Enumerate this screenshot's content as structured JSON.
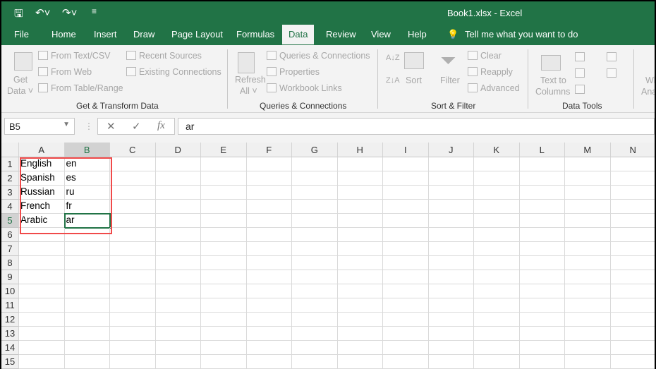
{
  "window": {
    "title": "Book1.xlsx  -  Excel"
  },
  "quick_access": {
    "icons": [
      "save-icon",
      "undo-icon",
      "redo-icon",
      "customize-icon"
    ]
  },
  "tabs": [
    {
      "label": "File"
    },
    {
      "label": "Home"
    },
    {
      "label": "Insert"
    },
    {
      "label": "Draw"
    },
    {
      "label": "Page Layout"
    },
    {
      "label": "Formulas"
    },
    {
      "label": "Data",
      "active": true
    },
    {
      "label": "Review"
    },
    {
      "label": "View"
    },
    {
      "label": "Help"
    }
  ],
  "tell_me": "Tell me what you want to do",
  "ribbon": {
    "get_transform": {
      "get_data": "Get",
      "get_data2": "Data ˅",
      "from_text": "From Text/CSV",
      "from_web": "From Web",
      "from_table": "From Table/Range",
      "recent": "Recent Sources",
      "existing": "Existing Connections",
      "label": "Get & Transform Data"
    },
    "queries": {
      "refresh": "Refresh",
      "refresh2": "All ˅",
      "queries_conn": "Queries & Connections",
      "properties": "Properties",
      "links": "Workbook Links",
      "label": "Queries & Connections"
    },
    "sort_filter": {
      "sort": "Sort",
      "filter": "Filter",
      "clear": "Clear",
      "reapply": "Reapply",
      "advanced": "Advanced",
      "label": "Sort & Filter",
      "az": "A↓Z",
      "za": "Z↓A"
    },
    "data_tools": {
      "text_to": "Text to",
      "columns": "Columns",
      "label": "Data Tools"
    },
    "whatif": {
      "l1": "Wh",
      "l2": "Ana"
    }
  },
  "formula_bar": {
    "name_box": "B5",
    "fx": "fx",
    "cancel": "✕",
    "enter": "✓",
    "value": "ar"
  },
  "sheet": {
    "columns": [
      "A",
      "B",
      "C",
      "D",
      "E",
      "F",
      "G",
      "H",
      "I",
      "J",
      "K",
      "L",
      "M",
      "N"
    ],
    "rows": [
      "1",
      "2",
      "3",
      "4",
      "5",
      "6",
      "7",
      "8",
      "9",
      "10",
      "11",
      "12",
      "13",
      "14",
      "15"
    ],
    "cells": [
      [
        "English",
        "en"
      ],
      [
        "Spanish",
        "es"
      ],
      [
        "Russian",
        "ru"
      ],
      [
        "French",
        "fr"
      ],
      [
        "Arabic",
        "ar"
      ]
    ],
    "active_cell": "B5",
    "highlight_color": "#f04a4a",
    "accent": "#217346"
  }
}
